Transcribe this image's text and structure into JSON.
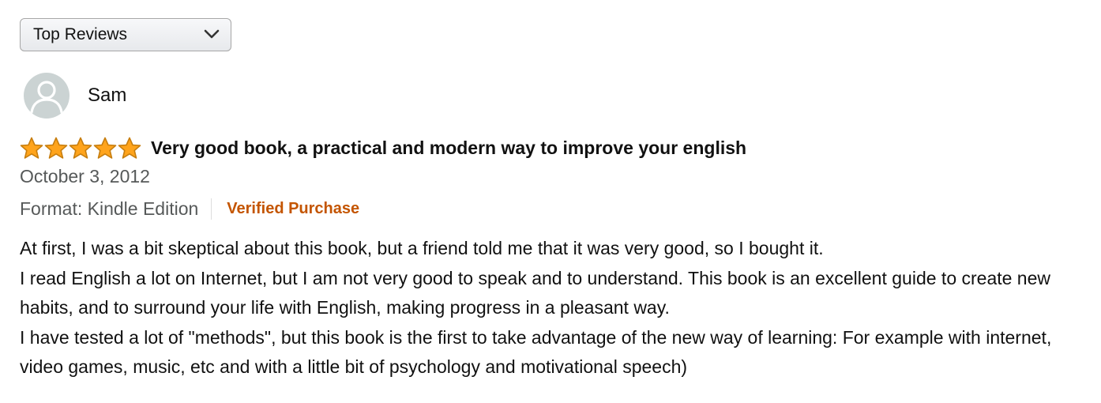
{
  "sort": {
    "selected": "Top Reviews",
    "icon": "chevron-down-icon"
  },
  "reviewer": {
    "name": "Sam",
    "avatar_icon": "user-silhouette-icon"
  },
  "review": {
    "rating": 5,
    "rating_max": 5,
    "star_color": "#ffa41c",
    "title": "Very good book, a practical and modern way to improve your english",
    "date": "October 3, 2012",
    "format": "Format: Kindle Edition",
    "verified": "Verified Purchase",
    "verified_color": "#c45500",
    "body": [
      "At first, I was a bit skeptical about this book, but a friend told me that it was very good, so I bought it.",
      "I read English a lot on Internet, but I am not very good to speak and to understand. This book is an excellent guide to create new habits, and to surround your life with English, making progress in a pleasant way.",
      "I have tested a lot of \"methods\", but this book is the first to take advantage of the new way of learning: For example with internet, video games, music, etc and with a little bit of psychology and motivational speech)"
    ]
  }
}
